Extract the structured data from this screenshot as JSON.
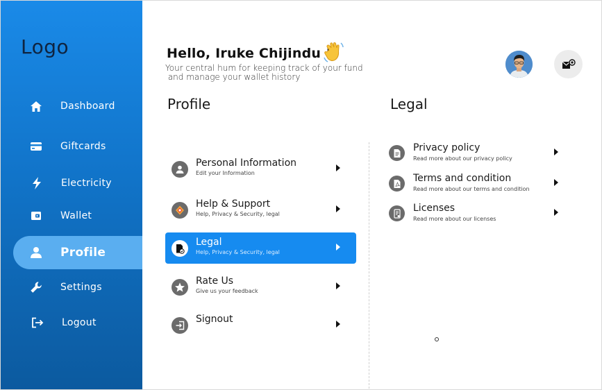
{
  "colors": {
    "sidebar_top": "#1a8ae8",
    "sidebar_bottom": "#0c5a9f",
    "active_nav": "#5aaef0",
    "active_item": "#168bf0"
  },
  "sidebar": {
    "logo": "Logo",
    "items": [
      {
        "label": "Dashboard",
        "icon": "home-icon"
      },
      {
        "label": "Giftcards",
        "icon": "card-icon"
      },
      {
        "label": "Electricity",
        "icon": "lightning-icon"
      },
      {
        "label": "Wallet",
        "icon": "wallet-icon"
      },
      {
        "label": "Profile",
        "icon": "user-icon",
        "active": true
      },
      {
        "label": "Settings",
        "icon": "wrench-icon"
      },
      {
        "label": "Logout",
        "icon": "logout-icon"
      }
    ]
  },
  "header": {
    "greeting": "Hello, Iruke Chijindu !",
    "subtitle_line1": "Your central hum for keeping track of your fund",
    "subtitle_line2": " and manage your wallet history"
  },
  "profile": {
    "title": "Profile",
    "items": [
      {
        "title": "Personal Information",
        "subtitle": "Edit your Information",
        "icon": "user-circle-icon"
      },
      {
        "title": "Help & Support",
        "subtitle": "Help, Privacy & Security, legal",
        "icon": "support-icon"
      },
      {
        "title": "Legal",
        "subtitle": "Help, Privacy & Security, legal",
        "icon": "legal-doc-icon",
        "active": true
      },
      {
        "title": "Rate Us",
        "subtitle": "Give us your feedback",
        "icon": "star-icon"
      },
      {
        "title": "Signout",
        "subtitle": "",
        "icon": "signout-icon"
      }
    ]
  },
  "legal": {
    "title": "Legal",
    "items": [
      {
        "title": "Privacy policy",
        "subtitle": "Read more about our privacy policy",
        "icon": "document-icon"
      },
      {
        "title": "Terms and condition",
        "subtitle": "Read more about our terms and condition",
        "icon": "pdf-document-icon"
      },
      {
        "title": "Licenses",
        "subtitle": "Read more about our licenses",
        "icon": "license-icon"
      }
    ]
  }
}
